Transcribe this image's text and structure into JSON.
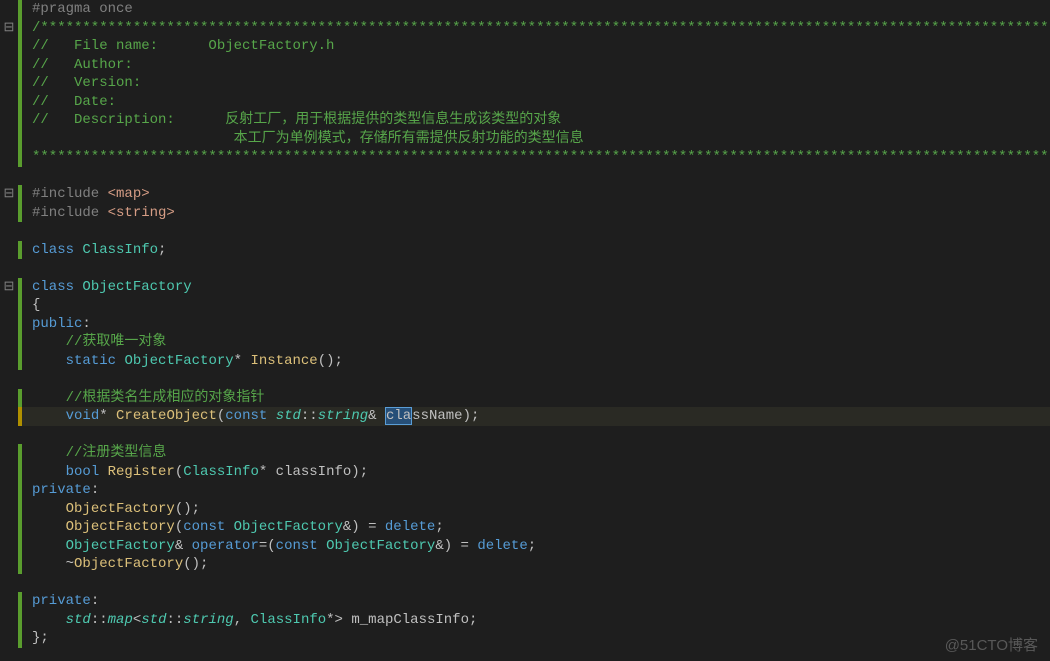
{
  "watermark": "@51CTO博客",
  "fold_symbol": "⊟",
  "lines": [
    {
      "bar": "green",
      "fold": "",
      "html": "<span class='t-pre'>#pragma</span> <span class='t-pre'>once</span>"
    },
    {
      "bar": "green",
      "fold": "fold",
      "html": "<span class='t-grn'>/*************************************************************************************************************************</span>"
    },
    {
      "bar": "green",
      "fold": "",
      "html": "<span class='t-grn'>//   File name:      ObjectFactory.h</span>"
    },
    {
      "bar": "green",
      "fold": "",
      "html": "<span class='t-grn'>//   Author:</span>"
    },
    {
      "bar": "green",
      "fold": "",
      "html": "<span class='t-grn'>//   Version:</span>"
    },
    {
      "bar": "green",
      "fold": "",
      "html": "<span class='t-grn'>//   Date:</span>"
    },
    {
      "bar": "green",
      "fold": "",
      "html": "<span class='t-grn'>//   Description:      反射工厂，用于根据提供的类型信息生成该类型的对象</span>"
    },
    {
      "bar": "green",
      "fold": "",
      "html": "<span class='t-grn'>                        本工厂为单例模式，存储所有需提供反射功能的类型信息</span>"
    },
    {
      "bar": "green",
      "fold": "",
      "html": "<span class='t-grn'>**************************************************************************************************************************/</span>"
    },
    {
      "bar": "",
      "fold": "",
      "html": ""
    },
    {
      "bar": "green",
      "fold": "fold",
      "html": "<span class='t-pre'>#include</span> <span class='t-str'>&lt;map&gt;</span>"
    },
    {
      "bar": "green",
      "fold": "",
      "html": "<span class='t-pre'>#include</span> <span class='t-str'>&lt;string&gt;</span>"
    },
    {
      "bar": "",
      "fold": "",
      "html": ""
    },
    {
      "bar": "green",
      "fold": "",
      "html": "<span class='t-kw'>class</span> <span class='t-type'>ClassInfo</span><span class='t-id'>;</span>"
    },
    {
      "bar": "",
      "fold": "",
      "html": ""
    },
    {
      "bar": "green",
      "fold": "fold",
      "html": "<span class='t-kw'>class</span> <span class='t-type'>ObjectFactory</span>"
    },
    {
      "bar": "green",
      "fold": "",
      "html": "<span class='t-brace'>{</span>"
    },
    {
      "bar": "green",
      "fold": "",
      "html": "<span class='t-kw'>public</span><span class='t-id'>:</span>"
    },
    {
      "bar": "green",
      "fold": "",
      "html": "    <span class='t-grn'>//获取唯一对象</span>"
    },
    {
      "bar": "green",
      "fold": "",
      "html": "    <span class='t-kw'>static</span> <span class='t-type'>ObjectFactory</span><span class='t-id'>*</span> <span class='t-fn'>Instance</span><span class='t-id'>();</span>"
    },
    {
      "bar": "",
      "fold": "",
      "html": ""
    },
    {
      "bar": "green",
      "fold": "",
      "html": "    <span class='t-grn'>//根据类名生成相应的对象指针</span>"
    },
    {
      "bar": "yellow",
      "fold": "",
      "hl": true,
      "html": "    <span class='t-kw'>void</span><span class='t-id'>*</span> <span class='t-fn'>CreateObject</span><span class='t-id'>(</span><span class='t-kw'>const</span> <span class='t-type t-it'>std</span><span class='t-id'>::</span><span class='t-type t-it'>string</span><span class='t-id'>&amp; </span><span class='t-sel' data-name='selection' data-interactable='false'>cla</span><span class='t-id'>ssName);</span>"
    },
    {
      "bar": "",
      "fold": "",
      "html": ""
    },
    {
      "bar": "green",
      "fold": "",
      "html": "    <span class='t-grn'>//注册类型信息</span>"
    },
    {
      "bar": "green",
      "fold": "",
      "html": "    <span class='t-kw'>bool</span> <span class='t-fn'>Register</span><span class='t-id'>(</span><span class='t-type'>ClassInfo</span><span class='t-id'>* classInfo);</span>"
    },
    {
      "bar": "green",
      "fold": "",
      "html": "<span class='t-kw'>private</span><span class='t-id'>:</span>"
    },
    {
      "bar": "green",
      "fold": "",
      "html": "    <span class='t-fn'>ObjectFactory</span><span class='t-id'>();</span>"
    },
    {
      "bar": "green",
      "fold": "",
      "html": "    <span class='t-fn'>ObjectFactory</span><span class='t-id'>(</span><span class='t-kw'>const</span> <span class='t-type'>ObjectFactory</span><span class='t-id'>&amp;) = </span><span class='t-kw'>delete</span><span class='t-id'>;</span>"
    },
    {
      "bar": "green",
      "fold": "",
      "html": "    <span class='t-type'>ObjectFactory</span><span class='t-id'>&amp; </span><span class='t-kw'>operator</span><span class='t-id'>=(</span><span class='t-kw'>const</span> <span class='t-type'>ObjectFactory</span><span class='t-id'>&amp;) = </span><span class='t-kw'>delete</span><span class='t-id'>;</span>"
    },
    {
      "bar": "green",
      "fold": "",
      "html": "    <span class='t-id'>~</span><span class='t-fn'>ObjectFactory</span><span class='t-id'>();</span>"
    },
    {
      "bar": "",
      "fold": "",
      "html": ""
    },
    {
      "bar": "green",
      "fold": "",
      "html": "<span class='t-kw'>private</span><span class='t-id'>:</span>"
    },
    {
      "bar": "green",
      "fold": "",
      "html": "    <span class='t-type t-it'>std</span><span class='t-id'>::</span><span class='t-type t-it'>map</span><span class='t-id'>&lt;</span><span class='t-type t-it'>std</span><span class='t-id'>::</span><span class='t-type t-it'>string</span><span class='t-id'>, </span><span class='t-type'>ClassInfo</span><span class='t-id'>*&gt; m_mapClassInfo;</span>"
    },
    {
      "bar": "green",
      "fold": "",
      "html": "<span class='t-brace'>};</span>"
    }
  ]
}
